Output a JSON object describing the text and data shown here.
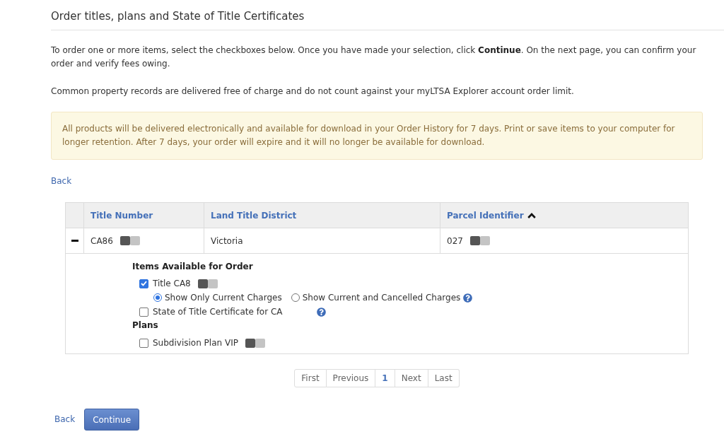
{
  "page": {
    "title": "Order titles, plans and State of Title Certificates"
  },
  "instructions": [
    "To order one or more items, select the checkboxes below. Once you have made your selection, click **Continue**. On the next page, you can confirm your order and verify fees owing.",
    "Common property records are delivered free of charge and do not count against your myLTSA Explorer account order limit."
  ],
  "notice": "All products will be delivered electronically and available for download in your Order History for 7 days. Print or save items to your computer for longer retention. After 7 days, your order will expire and it will no longer be available for download.",
  "top_link": "Back",
  "table": {
    "columns": [
      {
        "label": "Title Number",
        "sorted": false
      },
      {
        "label": "Land Title District",
        "sorted": false
      },
      {
        "label": "Parcel Identifier",
        "sorted": true
      }
    ],
    "rows": [
      {
        "expanded": true,
        "cells": [
          {
            "text": "CA86",
            "redacted": true
          },
          {
            "text": "Victoria",
            "redacted": false
          },
          {
            "text": "027",
            "redacted": true
          }
        ],
        "sections": [
          {
            "heading": "Items Available for Order",
            "items": [
              {
                "label": "Title CA8",
                "checked": true,
                "redacted": true,
                "help": false,
                "options": [
                  {
                    "label": "Show Only Current Charges",
                    "selected": true,
                    "help": false
                  },
                  {
                    "label": "Show Current and Cancelled Charges",
                    "selected": false,
                    "help": true
                  }
                ]
              },
              {
                "label": "State of Title Certificate for CA",
                "checked": false,
                "redacted": false,
                "help": true
              }
            ]
          },
          {
            "heading": "Plans",
            "items": [
              {
                "label": "Subdivision Plan VIP",
                "checked": false,
                "redacted": true,
                "help": false
              }
            ]
          }
        ]
      }
    ]
  },
  "pagination": [
    {
      "label": "First",
      "selected": false
    },
    {
      "label": "Previous",
      "selected": false
    },
    {
      "label": "1",
      "selected": true
    },
    {
      "label": "Next",
      "selected": false
    },
    {
      "label": "Last",
      "selected": false
    }
  ],
  "footer": {
    "link": "Back",
    "button": "Continue"
  }
}
